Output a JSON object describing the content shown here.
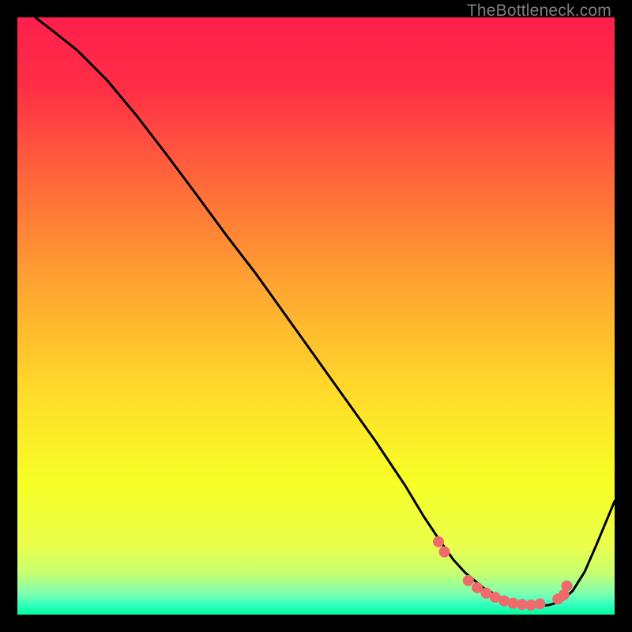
{
  "watermark": "TheBottleneck.com",
  "chart_data": {
    "type": "line",
    "title": "",
    "xlabel": "",
    "ylabel": "",
    "xlim": [
      0,
      100
    ],
    "ylim": [
      0,
      100
    ],
    "gradient_stops": [
      {
        "offset": 0.0,
        "color": "#ff1f4b"
      },
      {
        "offset": 0.12,
        "color": "#ff2f46"
      },
      {
        "offset": 0.28,
        "color": "#ff6a3a"
      },
      {
        "offset": 0.45,
        "color": "#ffa531"
      },
      {
        "offset": 0.62,
        "color": "#ffd92a"
      },
      {
        "offset": 0.78,
        "color": "#f7ff26"
      },
      {
        "offset": 0.885,
        "color": "#eaff4d"
      },
      {
        "offset": 0.93,
        "color": "#c8ff70"
      },
      {
        "offset": 0.965,
        "color": "#7dffb0"
      },
      {
        "offset": 0.985,
        "color": "#2cffbf"
      },
      {
        "offset": 1.0,
        "color": "#00ff99"
      }
    ],
    "series": [
      {
        "name": "bottleneck-curve",
        "x": [
          3,
          6,
          10,
          15,
          20,
          25,
          30,
          35,
          40,
          45,
          50,
          55,
          60,
          65,
          68,
          71,
          73,
          75,
          78,
          81,
          84,
          87,
          89,
          91,
          93,
          95,
          97,
          100
        ],
        "y": [
          100,
          97.7,
          94.5,
          89.5,
          83.5,
          77,
          70.3,
          63.5,
          57,
          50,
          43,
          36,
          29,
          21.5,
          16.5,
          12,
          9.2,
          7,
          4.5,
          2.8,
          1.8,
          1.4,
          1.6,
          2.2,
          4,
          7.2,
          11.8,
          19
        ]
      }
    ],
    "marker_points": {
      "name": "highlight-dots",
      "color": "#ef6a6a",
      "points": [
        {
          "x": 70.5,
          "y": 12.2
        },
        {
          "x": 71.5,
          "y": 10.5
        },
        {
          "x": 75.5,
          "y": 5.7
        },
        {
          "x": 77.0,
          "y": 4.5
        },
        {
          "x": 78.5,
          "y": 3.6
        },
        {
          "x": 80.0,
          "y": 2.9
        },
        {
          "x": 81.5,
          "y": 2.3
        },
        {
          "x": 83.0,
          "y": 1.9
        },
        {
          "x": 84.5,
          "y": 1.7
        },
        {
          "x": 86.0,
          "y": 1.6
        },
        {
          "x": 87.5,
          "y": 1.8
        },
        {
          "x": 90.5,
          "y": 2.6
        },
        {
          "x": 91.5,
          "y": 3.3
        },
        {
          "x": 92.0,
          "y": 4.8
        }
      ]
    }
  }
}
